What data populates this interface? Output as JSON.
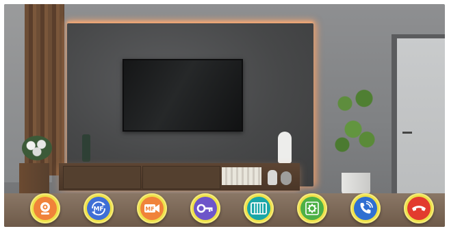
{
  "controls": [
    {
      "name": "camera-button",
      "icon": "webcam-icon",
      "color": "#f0833a"
    },
    {
      "name": "mf-photo-button",
      "icon": "mf-photo-icon",
      "label": "MF",
      "color": "#3f6fd6"
    },
    {
      "name": "mf-video-button",
      "icon": "mf-video-icon",
      "label": "MF",
      "color": "#f0833a"
    },
    {
      "name": "unlock-button",
      "icon": "key-icon",
      "color": "#6d55c9"
    },
    {
      "name": "gate-button",
      "icon": "gate-icon",
      "color": "#1aa6a8"
    },
    {
      "name": "settings-button",
      "icon": "gear-icon",
      "color": "#4db046"
    },
    {
      "name": "answer-call-button",
      "icon": "phone-answer-icon",
      "color": "#2f6fd1"
    },
    {
      "name": "hang-up-button",
      "icon": "phone-hangup-icon",
      "color": "#e23b2e"
    }
  ]
}
